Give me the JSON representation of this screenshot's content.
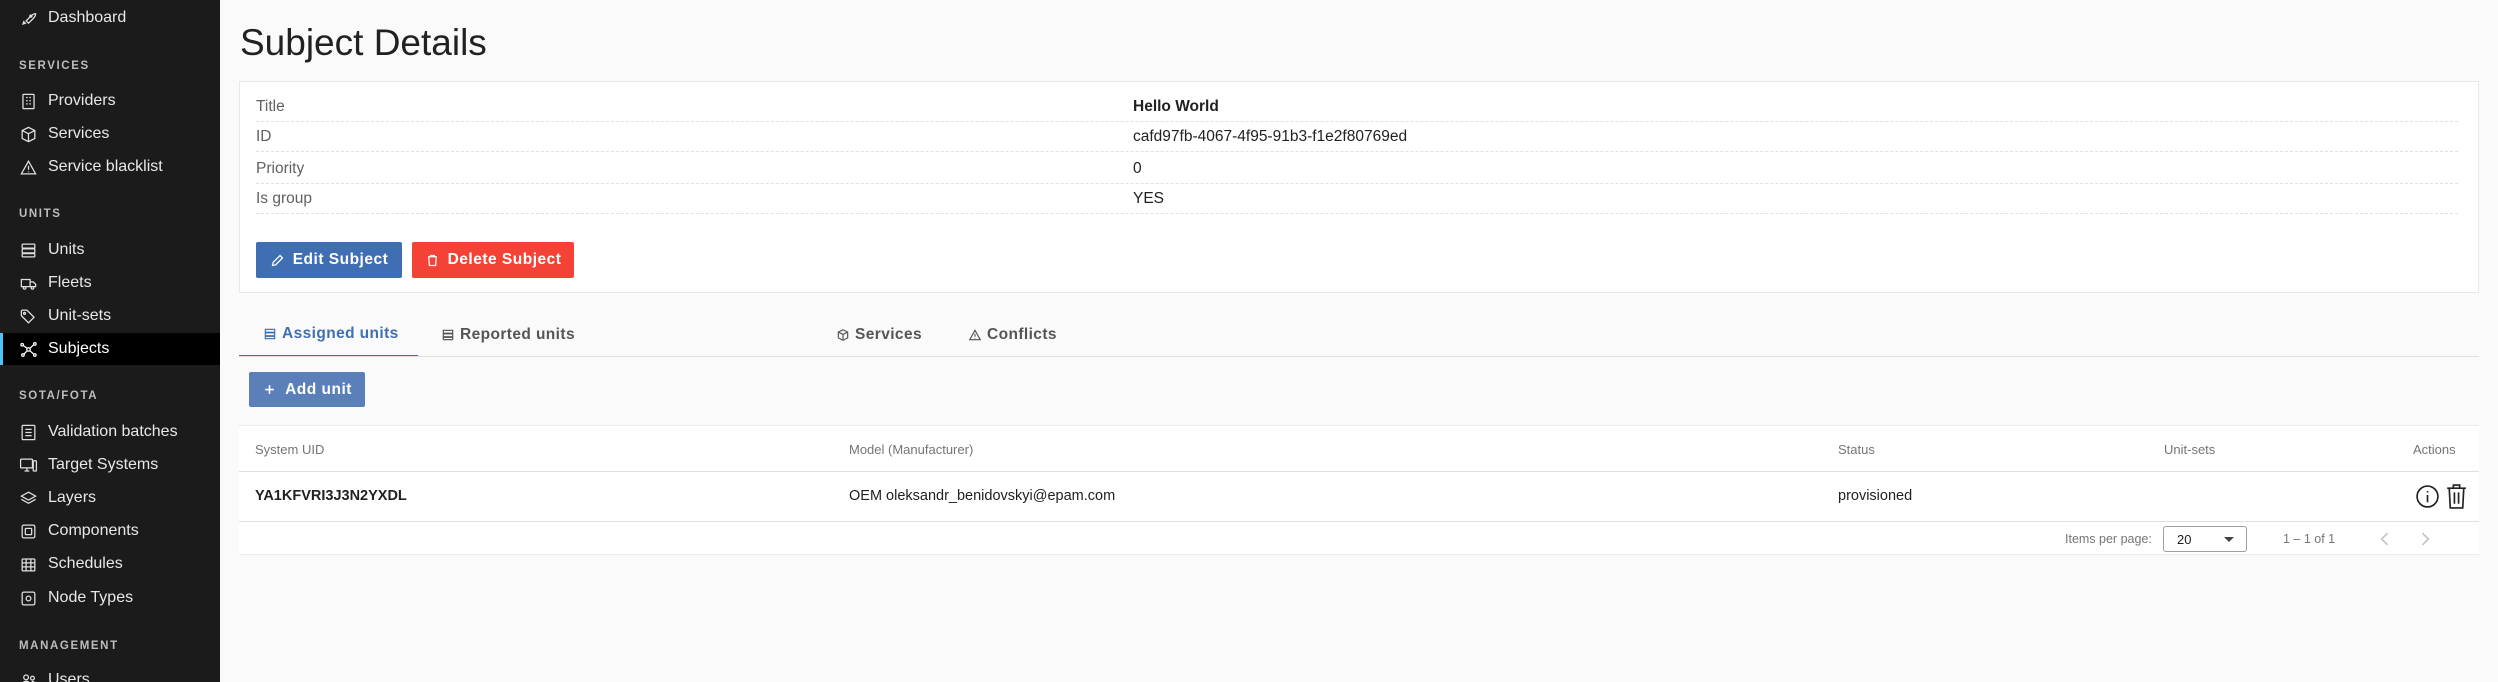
{
  "sidebar": {
    "top_item": {
      "label": "Dashboard",
      "icon": "rocket-icon"
    },
    "sections": [
      {
        "title": "SERVICES"
      },
      {
        "title": "UNITS"
      },
      {
        "title": "SOTA/FOTA"
      },
      {
        "title": "MANAGEMENT"
      }
    ],
    "items": [
      {
        "label": "Providers",
        "icon": "building-icon"
      },
      {
        "label": "Services",
        "icon": "box-icon"
      },
      {
        "label": "Service blacklist",
        "icon": "warning-icon"
      },
      {
        "label": "Units",
        "icon": "server-icon"
      },
      {
        "label": "Fleets",
        "icon": "truck-icon"
      },
      {
        "label": "Unit-sets",
        "icon": "tags-icon"
      },
      {
        "label": "Subjects",
        "icon": "network-icon"
      },
      {
        "label": "Validation batches",
        "icon": "list-icon"
      },
      {
        "label": "Target Systems",
        "icon": "desktop-icon"
      },
      {
        "label": "Layers",
        "icon": "layers-icon"
      },
      {
        "label": "Components",
        "icon": "puzzle-icon"
      },
      {
        "label": "Schedules",
        "icon": "calendar-icon"
      },
      {
        "label": "Node Types",
        "icon": "node-icon"
      },
      {
        "label": "Users",
        "icon": "users-icon"
      }
    ],
    "active_item": "Subjects",
    "accent_color": "#4fc3f7"
  },
  "page": {
    "title": "Subject Details"
  },
  "details": {
    "rows": [
      {
        "label": "Title",
        "value": "Hello World"
      },
      {
        "label": "ID",
        "value": "cafd97fb-4067-4f95-91b3-f1e2f80769ed"
      },
      {
        "label": "Priority",
        "value": "0"
      },
      {
        "label": "Is group",
        "value": "YES"
      }
    ],
    "edit_button": "Edit Subject",
    "delete_button": "Delete Subject",
    "edit_color": "#3f6fb2",
    "delete_color": "#f44336"
  },
  "tabs": [
    {
      "label": "Assigned units",
      "icon": "server-icon",
      "active": true
    },
    {
      "label": "Reported units",
      "icon": "server-icon"
    },
    {
      "label": "Services",
      "icon": "box-icon"
    },
    {
      "label": "Conflicts",
      "icon": "warning-icon"
    }
  ],
  "table": {
    "add_button": "Add unit",
    "columns": [
      "System UID",
      "Model (Manufacturer)",
      "Status",
      "Unit-sets",
      "Actions"
    ],
    "rows": [
      {
        "system_uid": "YA1KFVRI3J3N2YXDL",
        "model": "OEM oleksandr_benidovskyi@epam.com",
        "status": "provisioned",
        "unit_sets": ""
      }
    ],
    "paginator": {
      "items_per_page_label": "Items per page:",
      "items_per_page": "20",
      "range": "1 – 1 of 1"
    }
  }
}
